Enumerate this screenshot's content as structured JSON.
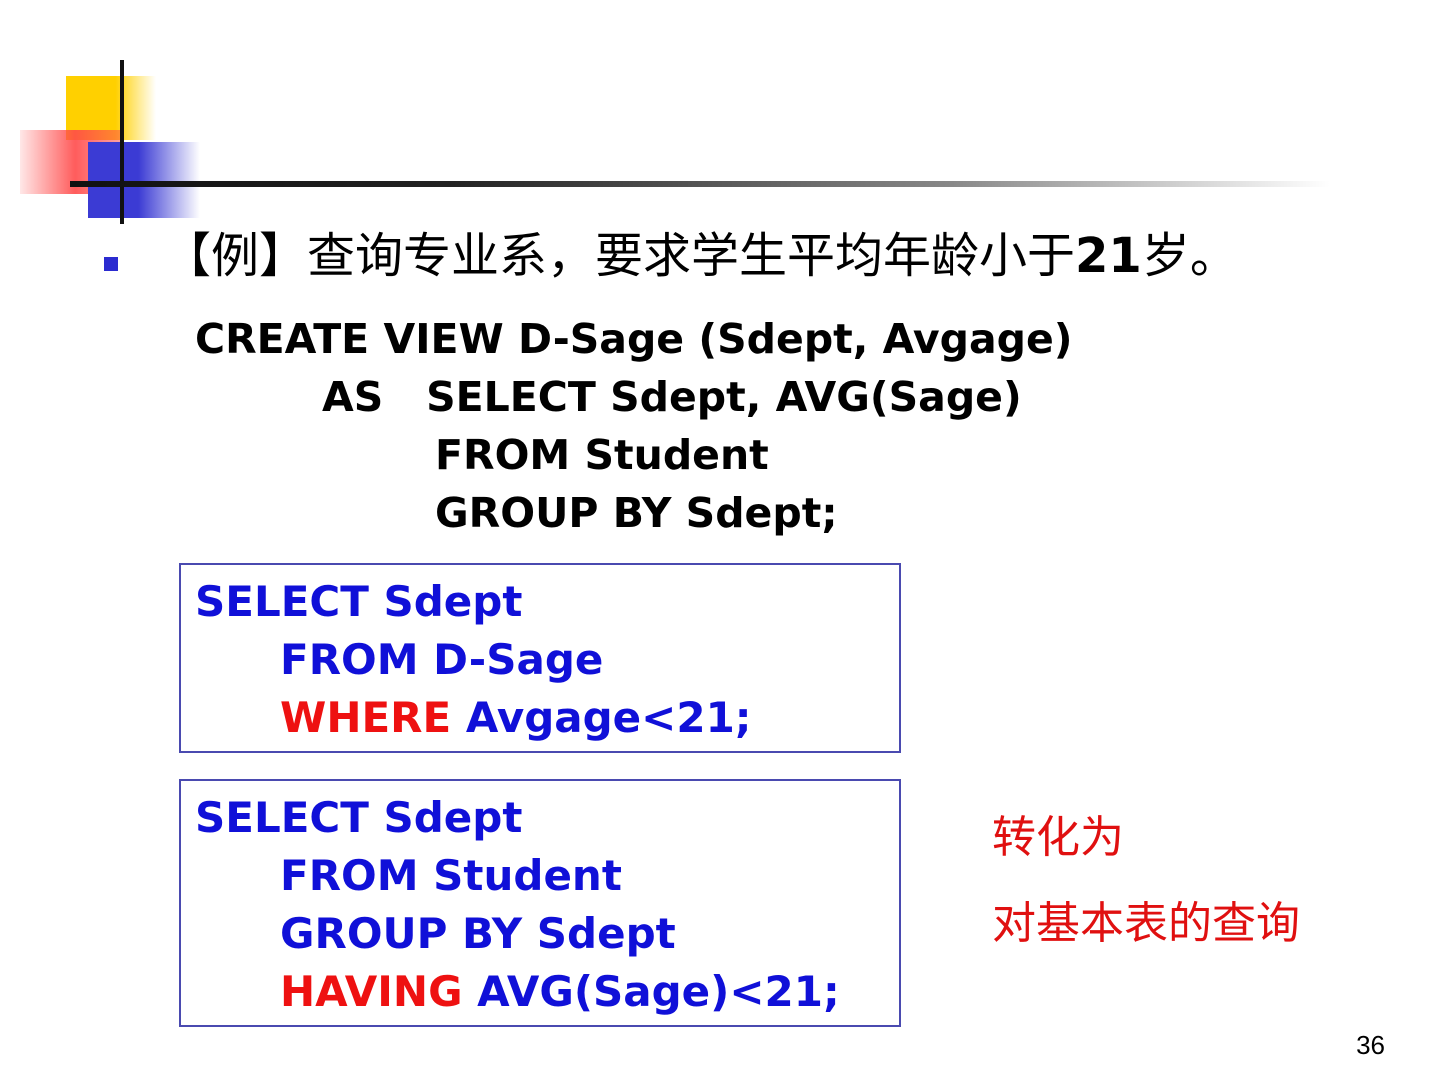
{
  "title": {
    "text": "【例】查询专业系，要求学生平均年龄小于",
    "number": "21",
    "suffix": "岁。"
  },
  "view_sql": [
    "CREATE VIEW D-Sage (Sdept, Avgage)",
    "AS   SELECT Sdept, AVG(Sage)",
    "FROM Student",
    "GROUP BY Sdept;"
  ],
  "query_box": {
    "line1": "SELECT Sdept",
    "line2": "FROM D-Sage",
    "line3_keyword": "WHERE",
    "line3_rest": " Avgage<21;"
  },
  "converted_box": {
    "line1": "SELECT Sdept",
    "line2": "FROM Student",
    "line3": "GROUP BY Sdept",
    "line4_keyword": "HAVING",
    "line4_rest": " AVG(Sage)<21;"
  },
  "note": {
    "line1": "转化为",
    "line2": "对基本表的查询"
  },
  "page_number": "36",
  "colors": {
    "code_blue": "#1010d8",
    "keyword_red": "#ee1111",
    "note_red": "#e01010",
    "bullet_blue": "#2b2bd0"
  }
}
